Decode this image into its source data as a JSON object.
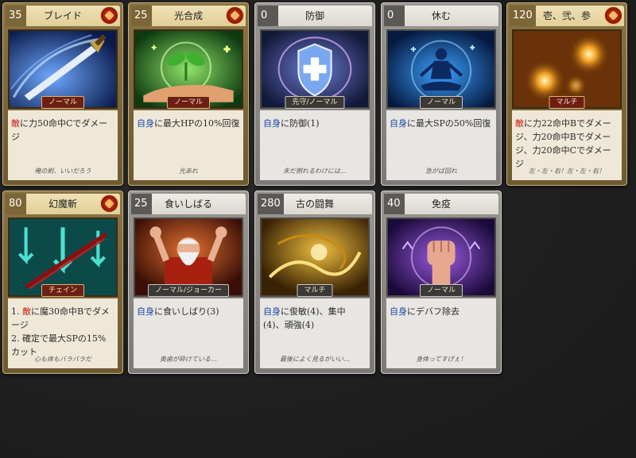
{
  "cards": [
    {
      "cost": "35",
      "name": "ブレイド",
      "tag": "ノーマル",
      "flavor": "俺の剣、いいだろう",
      "desc": [
        {
          "t": "敵",
          "c": "red"
        },
        {
          "t": "に力50命中Cでダメージ"
        }
      ]
    },
    {
      "cost": "25",
      "name": "光合成",
      "tag": "ノーマル",
      "flavor": "光あれ",
      "desc": [
        {
          "t": "自身",
          "c": "blue"
        },
        {
          "t": "に最大HPの10%回復"
        }
      ]
    },
    {
      "cost": "0",
      "name": "防御",
      "tag": "先守/ノーマル",
      "flavor": "未だ倒れるわけには…",
      "desc": [
        {
          "t": "自身",
          "c": "blue"
        },
        {
          "t": "に防御(1)"
        }
      ]
    },
    {
      "cost": "0",
      "name": "休む",
      "tag": "ノーマル",
      "flavor": "急がば回れ",
      "desc": [
        {
          "t": "自身",
          "c": "blue"
        },
        {
          "t": "に最大SPの50%回復"
        }
      ]
    },
    {
      "cost": "120",
      "name": "壱、弐、参",
      "tag": "マルチ",
      "flavor": "左・左・右！左・左・右！",
      "desc": [
        {
          "t": "敵",
          "c": "red"
        },
        {
          "t": "に力22命中Bでダメージ、力20命中Bでダメージ、力20命中Cでダメージ"
        }
      ]
    },
    {
      "cost": "80",
      "name": "幻魔斬",
      "tag": "チェイン",
      "flavor": "心も体もバラバラだ",
      "desc": [
        {
          "t": "1. "
        },
        {
          "t": "敵",
          "c": "red"
        },
        {
          "t": "に魔30命中Bでダメージ"
        },
        {
          "br": true
        },
        {
          "t": "2. 確定で最大SPの15%カット"
        }
      ]
    },
    {
      "cost": "25",
      "name": "食いしばる",
      "tag": "ノーマル/ジョーカー",
      "flavor": "奥歯が砕けている…",
      "desc": [
        {
          "t": "自身",
          "c": "blue"
        },
        {
          "t": "に食いしばり(3)"
        }
      ]
    },
    {
      "cost": "280",
      "name": "古の闘舞",
      "tag": "マルチ",
      "flavor": "最後によく見るがいい…",
      "desc": [
        {
          "t": "自身",
          "c": "blue"
        },
        {
          "t": "に俊敏(4)、集中(4)、頑強(4)"
        }
      ]
    },
    {
      "cost": "40",
      "name": "免疫",
      "tag": "ノーマル",
      "flavor": "身体ってすげぇ！",
      "desc": [
        {
          "t": "自身",
          "c": "blue"
        },
        {
          "t": "にデバフ除去"
        }
      ]
    }
  ]
}
